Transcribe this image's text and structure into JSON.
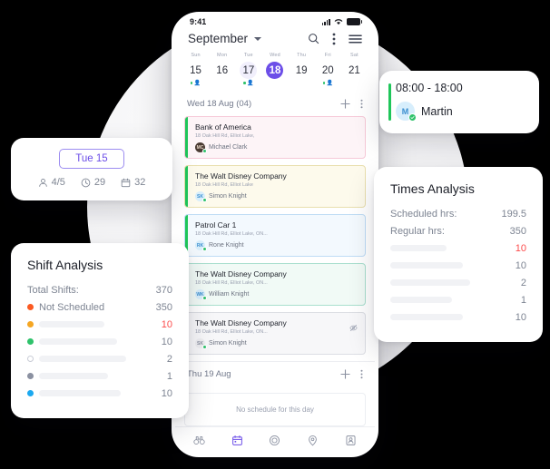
{
  "phone": {
    "status_bar": {
      "time": "9:41",
      "signal_icon": "signal-bars-icon",
      "wifi_icon": "wifi-icon",
      "battery_icon": "battery-icon"
    },
    "header": {
      "month": "September",
      "dropdown_icon": "chevron-down-icon",
      "search_icon": "search-icon",
      "more_icon": "more-vertical-icon",
      "menu_icon": "hamburger-menu-icon"
    },
    "week": [
      {
        "dow": "Sun",
        "day": "15",
        "state": "normal",
        "marker": true
      },
      {
        "dow": "Mon",
        "day": "16",
        "state": "normal",
        "marker": false
      },
      {
        "dow": "Tue",
        "day": "17",
        "state": "soft",
        "marker": true
      },
      {
        "dow": "Wed",
        "day": "18",
        "state": "active",
        "marker": false
      },
      {
        "dow": "Thu",
        "day": "19",
        "state": "normal",
        "marker": false
      },
      {
        "dow": "Fri",
        "day": "20",
        "state": "normal",
        "marker": true
      },
      {
        "dow": "Sat",
        "day": "21",
        "state": "normal",
        "marker": false
      }
    ],
    "day_section": {
      "label": "Wed 18 Aug (04)",
      "add_icon": "plus-icon",
      "more_icon": "more-vertical-icon"
    },
    "schedules": [
      {
        "title": "Bank of America",
        "address": "18 Oak Hill Rd, Elliot Lake,",
        "person": "Michael Clark",
        "initials": "MC",
        "avatar_bg": "#4a3b33",
        "avatar_color": "#e8d7c8",
        "accent": "#1fc65a",
        "border": "#f6c9d8",
        "bg": "#fdf4f7",
        "hidden": false
      },
      {
        "title": "The Walt Disney Company",
        "address": "18 Oak Hill Rd, Elliot Lake",
        "person": "Simon Knight",
        "initials": "SK",
        "avatar_bg": "#d8eefb",
        "avatar_color": "#3b8fd0",
        "accent": "#1fc65a",
        "border": "#e9dfae",
        "bg": "#fdfaec",
        "hidden": false
      },
      {
        "title": "Patrol Car 1",
        "address": "18 Oak Hill Rd, Elliot Lake, ON...",
        "person": "Rone Knight",
        "initials": "RK",
        "avatar_bg": "#d8eefb",
        "avatar_color": "#3b8fd0",
        "accent": "#1fc65a",
        "border": "#bfdcf5",
        "bg": "#f3f9fe",
        "hidden": false
      },
      {
        "title": "The Walt Disney Company",
        "address": "18 Oak Hill Rd, Elliot Lake, ON...",
        "person": "William Knight",
        "initials": "WK",
        "avatar_bg": "#d8eefb",
        "avatar_color": "#3b8fd0",
        "accent": "#f2c230",
        "border": "#a9dfce",
        "bg": "#f1faf6",
        "hidden": false
      },
      {
        "title": "The Walt Disney Company",
        "address": "18 Oak Hill Rd, Elliot Lake, ON...",
        "person": "Simon Knight",
        "initials": "SK",
        "avatar_bg": "#ededf0",
        "avatar_color": "#8a90a0",
        "accent": "#c8cbd3",
        "border": "#dcdee4",
        "bg": "#f7f7f9",
        "hidden": true,
        "hidden_icon": "eye-off-icon"
      }
    ],
    "next_day_section": {
      "label": "Thu 19 Aug",
      "add_icon": "plus-icon",
      "more_icon": "more-vertical-icon"
    },
    "empty_message": "No schedule for this day",
    "bottom_nav": [
      {
        "label": "Watch",
        "icon": "binoculars-icon",
        "active": false
      },
      {
        "label": "Schedule",
        "icon": "calendar-icon",
        "active": true
      },
      {
        "label": "Home",
        "icon": "spiral-home-icon",
        "active": false
      },
      {
        "label": "Site",
        "icon": "map-pin-icon",
        "active": false
      },
      {
        "label": "Guard",
        "icon": "guard-badge-icon",
        "active": false
      }
    ]
  },
  "day_card": {
    "pill_label": "Tue 15",
    "metrics": [
      {
        "icon": "person-icon",
        "value": "4/5"
      },
      {
        "icon": "clock-icon",
        "value": "29"
      },
      {
        "icon": "calendar-icon",
        "value": "32"
      }
    ]
  },
  "shift_card": {
    "time_range": "08:00 - 18:00",
    "person": "Martin",
    "initial": "M",
    "accent_color": "#1fc65a",
    "check_icon": "check-badge-icon"
  },
  "shift_analysis": {
    "title": "Shift Analysis",
    "rows": [
      {
        "label": "Total Shifts:",
        "value": "370",
        "bullet": null,
        "skeleton": null,
        "danger": false
      },
      {
        "label": "Not Scheduled",
        "value": "350",
        "bullet": "#fb5a22",
        "skeleton": null,
        "danger": false
      },
      {
        "label": "",
        "value": "10",
        "bullet": "#f5a623",
        "skeleton": 72,
        "danger": true
      },
      {
        "label": "",
        "value": "10",
        "bullet": "#2fc26b",
        "skeleton": 86,
        "danger": false
      },
      {
        "label": "",
        "value": "2",
        "bullet": "hollow",
        "skeleton": 96,
        "danger": false
      },
      {
        "label": "",
        "value": "1",
        "bullet": "#8b91a1",
        "skeleton": 76,
        "danger": false
      },
      {
        "label": "",
        "value": "10",
        "bullet": "#1ca9f0",
        "skeleton": 90,
        "danger": false
      }
    ]
  },
  "times_analysis": {
    "title": "Times Analysis",
    "rows": [
      {
        "label": "Scheduled hrs:",
        "value": "199.5",
        "skeleton": null,
        "danger": false
      },
      {
        "label": "Regular hrs:",
        "value": "350",
        "skeleton": null,
        "danger": false
      },
      {
        "label": "",
        "value": "10",
        "skeleton": 62,
        "danger": true
      },
      {
        "label": "",
        "value": "10",
        "skeleton": 80,
        "danger": false
      },
      {
        "label": "",
        "value": "2",
        "skeleton": 88,
        "danger": false
      },
      {
        "label": "",
        "value": "1",
        "skeleton": 68,
        "danger": false
      },
      {
        "label": "",
        "value": "10",
        "skeleton": 80,
        "danger": false
      }
    ]
  }
}
